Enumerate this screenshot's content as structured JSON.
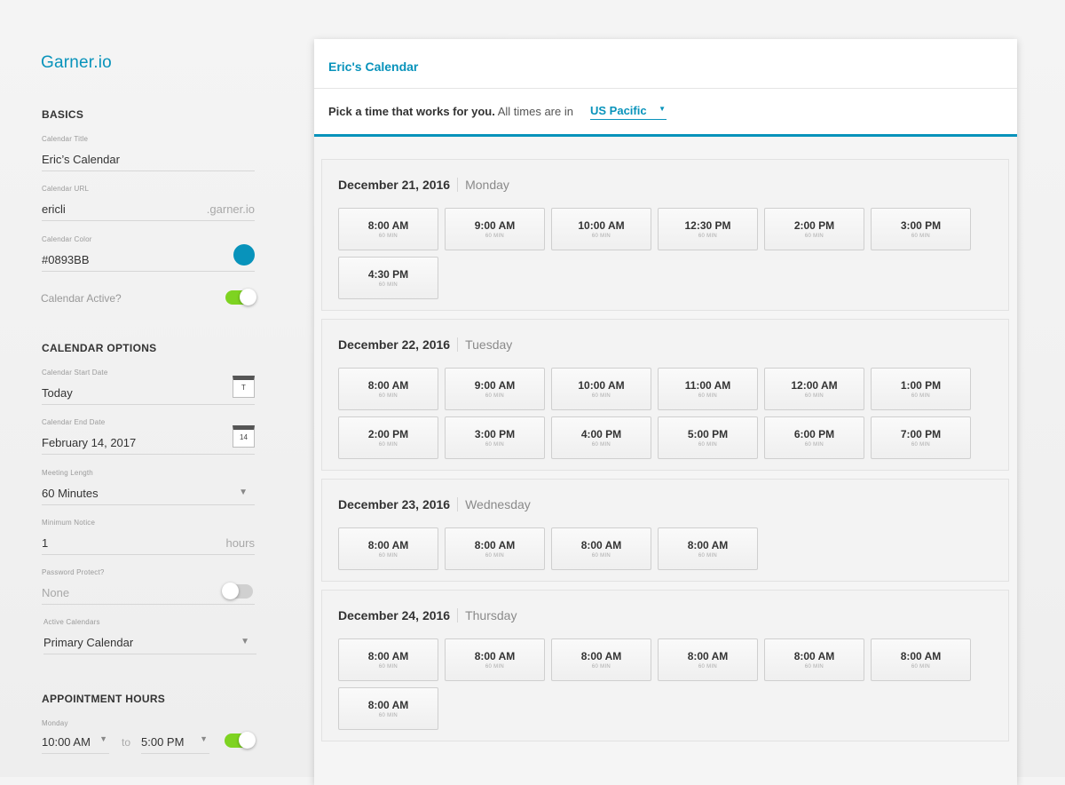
{
  "sidebar": {
    "brand": "Garner.io",
    "basics_title": "BASICS",
    "calendar_title": {
      "label": "Calendar Title",
      "value": "Eric’s Calendar"
    },
    "calendar_url": {
      "label": "Calendar URL",
      "value": "ericli",
      "suffix": ".garner.io"
    },
    "calendar_color": {
      "label": "Calendar Color",
      "value": "#0893BB",
      "swatch": "#0893BB"
    },
    "calendar_active": {
      "label": "Calendar Active?",
      "on": true
    },
    "options_title": "CALENDAR OPTIONS",
    "start_date": {
      "label": "Calendar Start Date",
      "value": "Today",
      "icon_text": "T"
    },
    "end_date": {
      "label": "Calendar End Date",
      "value": "February 14, 2017",
      "icon_text": "14"
    },
    "meeting_length": {
      "label": "Meeting Length",
      "value": "60 Minutes"
    },
    "minimum_notice": {
      "label": "Minimum Notice",
      "value": "1",
      "suffix": "hours"
    },
    "password_protect": {
      "label": "Password Protect?",
      "value": "None",
      "on": false
    },
    "active_calendars": {
      "label": "Active Calendars",
      "value": "Primary Calendar"
    },
    "hours_title": "APPOINTMENT HOURS",
    "monday": {
      "label": "Monday",
      "start": "10:00 AM",
      "to": "to",
      "end": "5:00 PM",
      "on": true
    }
  },
  "main": {
    "title": "Eric's Calendar",
    "prompt_bold": "Pick a time that works for you.",
    "prompt_rest": " All times are in",
    "timezone": "US Pacific",
    "days": [
      {
        "date": "December 21, 2016",
        "weekday": "Monday",
        "slots": [
          "8:00 AM",
          "9:00 AM",
          "10:00 AM",
          "12:30 PM",
          "2:00 PM",
          "3:00 PM",
          "4:30 PM"
        ]
      },
      {
        "date": "December 22, 2016",
        "weekday": "Tuesday",
        "slots": [
          "8:00 AM",
          "9:00 AM",
          "10:00 AM",
          "11:00 AM",
          "12:00 AM",
          "1:00 PM",
          "2:00 PM",
          "3:00 PM",
          "4:00 PM",
          "5:00 PM",
          "6:00 PM",
          "7:00 PM"
        ]
      },
      {
        "date": "December 23, 2016",
        "weekday": "Wednesday",
        "slots": [
          "8:00 AM",
          "8:00 AM",
          "8:00 AM",
          "8:00 AM"
        ]
      },
      {
        "date": "December 24, 2016",
        "weekday": "Thursday",
        "slots": [
          "8:00 AM",
          "8:00 AM",
          "8:00 AM",
          "8:00 AM",
          "8:00 AM",
          "8:00 AM",
          "8:00 AM"
        ]
      }
    ],
    "slot_duration": "60 MIN"
  },
  "colors": {
    "accent": "#0893BB",
    "toggle_on": "#7ed321",
    "toggle_off": "#d0d0d0"
  }
}
